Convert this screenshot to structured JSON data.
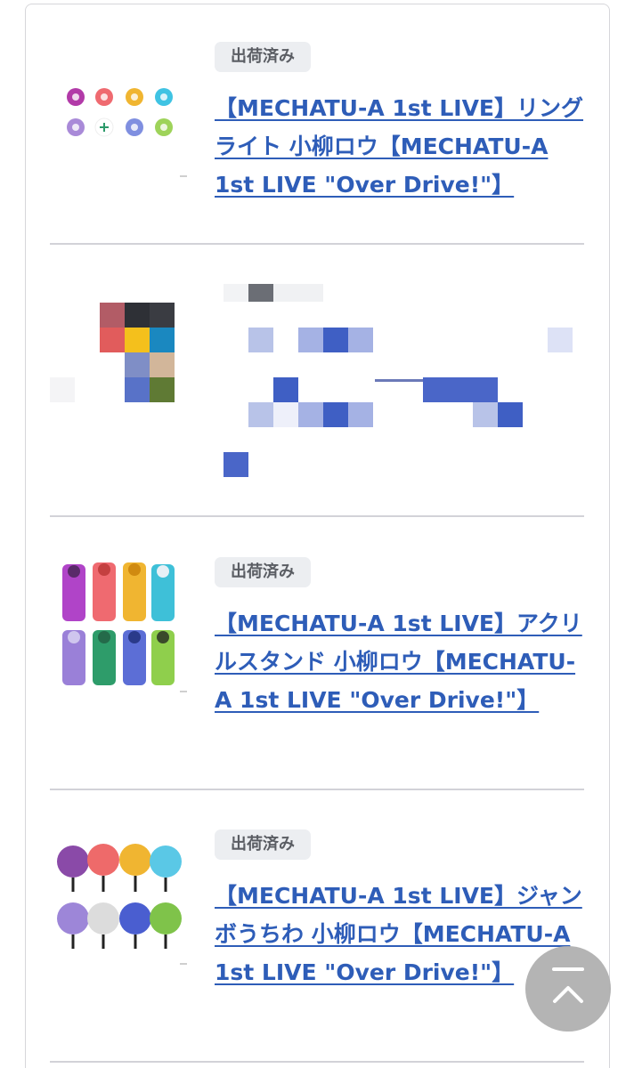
{
  "items": [
    {
      "status": "出荷済み",
      "title": "【MECHATU-A 1st LIVE】リングライト 小柳ロウ【MECHATU-A 1st LIVE \"Over Drive!\"】",
      "thumb_icon": "ring-light-icons"
    },
    {
      "status": "",
      "title": "",
      "thumb_icon": "pixelated-image"
    },
    {
      "status": "出荷済み",
      "title": "【MECHATU-A 1st LIVE】アクリルスタンド 小柳ロウ【MECHATU-A 1st LIVE \"Over Drive!\"】",
      "thumb_icon": "acrylic-stand-figures"
    },
    {
      "status": "出荷済み",
      "title": "【MECHATU-A 1st LIVE】ジャンボうちわ 小柳ロウ【MECHATU-A 1st LIVE \"Over Drive!\"】",
      "thumb_icon": "jumbo-fan-figures"
    }
  ],
  "scroll_top": {
    "icon": "chevron-up-icon"
  },
  "colors": {
    "link": "#2e5db8",
    "badge_bg": "#eceef1",
    "badge_text": "#5a5d63",
    "divider": "#d2d2d8",
    "scroll_button": "#aeaeae"
  }
}
